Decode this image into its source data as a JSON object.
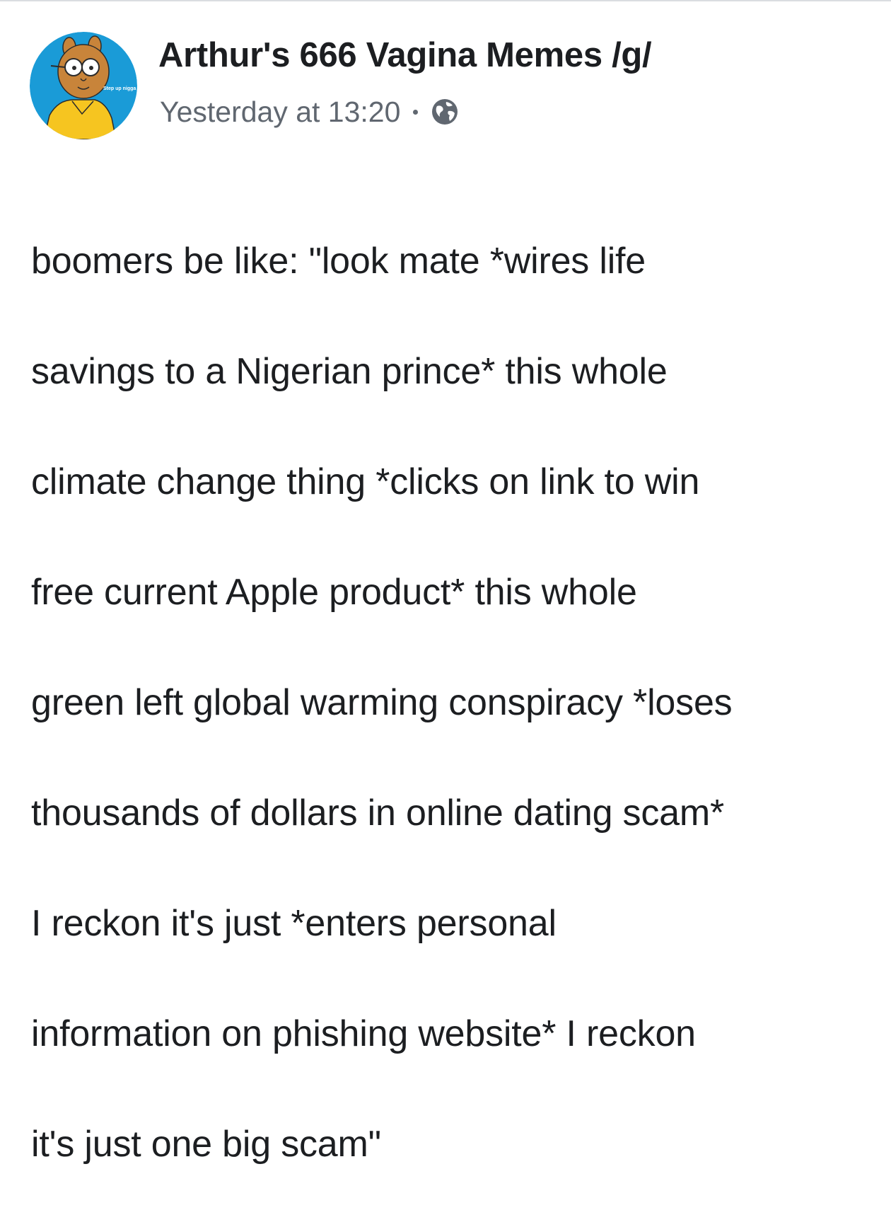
{
  "post": {
    "author": {
      "name": "Arthur's 666 Vagina Memes /g/",
      "avatar_icon": "cartoon-aardvark-avatar-icon",
      "avatar_caption": "Step up nigga"
    },
    "timestamp": "Yesterday at 13:20",
    "separator": "·",
    "privacy_icon": "globe-icon",
    "text_lines": [
      "boomers be like: \"look mate *wires life",
      "savings to a Nigerian prince* this whole",
      "climate change thing *clicks on link to win",
      "free current Apple product* this whole",
      "green left global warming conspiracy *loses",
      "thousands of dollars in online dating scam*",
      "I reckon it's just *enters personal",
      "information on phishing website* I reckon",
      "it's just one big scam\""
    ]
  },
  "colors": {
    "text": "#1c1e21",
    "meta": "#606770",
    "avatar_bg": "#1a9bd7",
    "avatar_face": "#c8843a",
    "avatar_shirt": "#f6c520"
  }
}
